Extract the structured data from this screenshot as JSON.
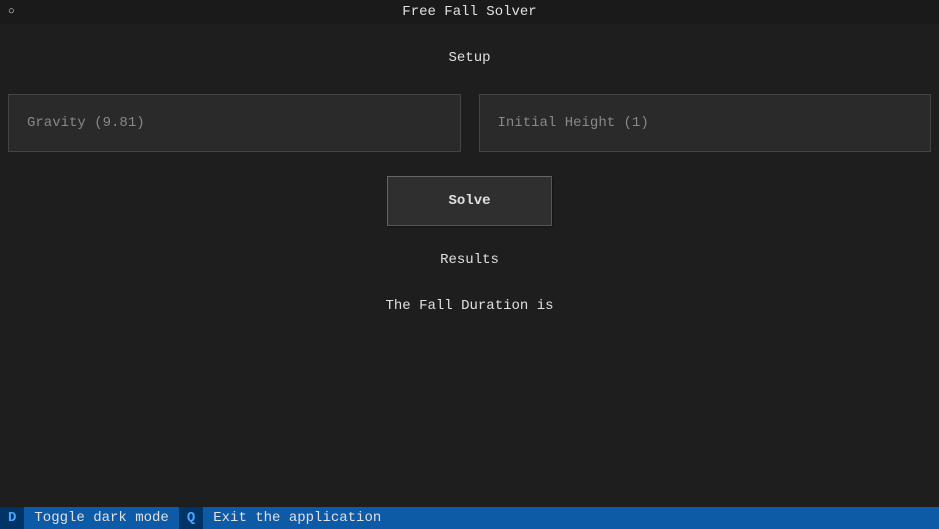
{
  "titleBar": {
    "icon": "○",
    "title": "Free Fall Solver"
  },
  "setup": {
    "heading": "Setup",
    "gravity": {
      "placeholder": "Gravity (9.81)",
      "value": ""
    },
    "initialHeight": {
      "placeholder": "Initial Height (1)",
      "value": ""
    },
    "solveLabel": "Solve"
  },
  "results": {
    "heading": "Results",
    "text": "The Fall Duration is "
  },
  "footer": {
    "items": [
      {
        "key": "D",
        "label": "Toggle dark mode"
      },
      {
        "key": "Q",
        "label": "Exit the application"
      }
    ]
  }
}
